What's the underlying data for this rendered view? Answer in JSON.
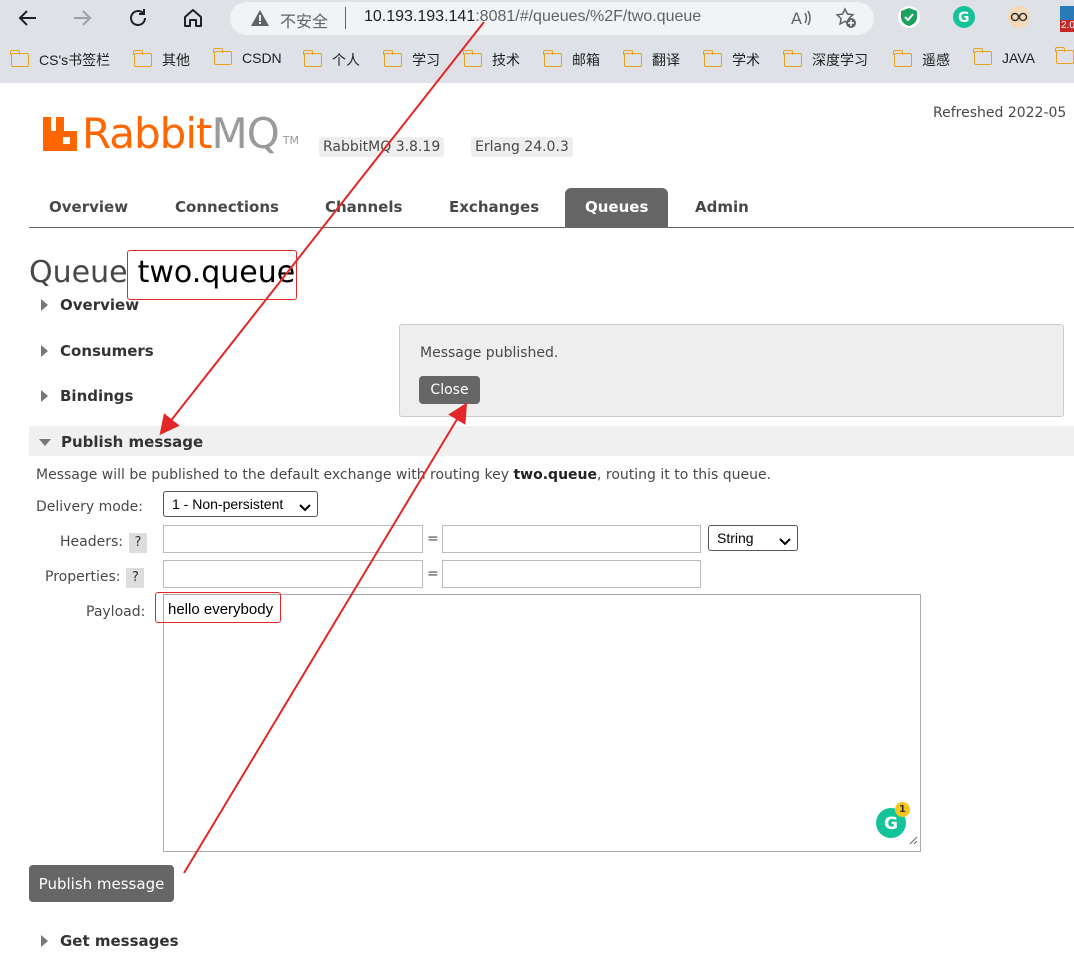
{
  "browser": {
    "insecure_label": "不安全",
    "url_host": "10.193.193.141",
    "url_rest": ":8081/#/queues/%2F/two.queue",
    "ext_badge": "2.0"
  },
  "bookmarks": [
    "CS's书签栏",
    "其他",
    "CSDN",
    "个人",
    "学习",
    "技术",
    "邮箱",
    "翻译",
    "学术",
    "深度学习",
    "遥感",
    "JAVA"
  ],
  "header": {
    "refreshed": "Refreshed 2022-05",
    "logo_rabbit": "Rabbit",
    "logo_mq": "MQ",
    "logo_tm": "TM",
    "rabbitmq_version": "RabbitMQ 3.8.19",
    "erlang_version": "Erlang 24.0.3"
  },
  "nav": {
    "tabs": [
      "Overview",
      "Connections",
      "Channels",
      "Exchanges",
      "Queues",
      "Admin"
    ],
    "active": "Queues"
  },
  "queue": {
    "title_prefix": "Queue",
    "name": "two.queue"
  },
  "sections": {
    "overview": "Overview",
    "consumers": "Consumers",
    "bindings": "Bindings",
    "publish": "Publish message",
    "get": "Get messages"
  },
  "popup": {
    "message": "Message published.",
    "close_label": "Close"
  },
  "publish": {
    "info_prefix": "Message will be published to the default exchange with routing key ",
    "routing_key": "two.queue",
    "info_suffix": ", routing it to this queue.",
    "delivery_mode_label": "Delivery mode:",
    "delivery_mode_value": "1 - Non-persistent",
    "headers_label": "Headers:",
    "properties_label": "Properties:",
    "help_label": "?",
    "equals": "=",
    "header_type": "String",
    "payload_label": "Payload:",
    "payload_value": "hello everybody",
    "grammarly_count": "1",
    "button_label": "Publish message"
  },
  "annotation_color": "#e32626"
}
